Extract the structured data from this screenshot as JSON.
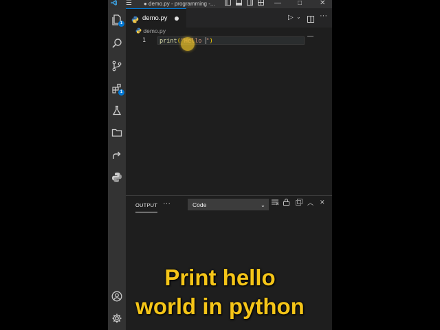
{
  "window": {
    "title": "● demo.py - programming -..."
  },
  "activity_bar": {
    "items": [
      {
        "name": "explorer-icon",
        "badge": "1"
      },
      {
        "name": "search-icon"
      },
      {
        "name": "source-control-icon"
      },
      {
        "name": "extensions-icon",
        "badge": "1"
      },
      {
        "name": "testing-icon"
      },
      {
        "name": "folder-icon"
      },
      {
        "name": "remote-explorer-icon"
      },
      {
        "name": "python-icon"
      }
    ],
    "bottom": [
      {
        "name": "account-icon"
      },
      {
        "name": "settings-gear-icon"
      }
    ]
  },
  "tab": {
    "label": "demo.py",
    "dirty": true
  },
  "breadcrumb": {
    "file": "demo.py"
  },
  "editor": {
    "line_number": "1",
    "code_fn": "print",
    "code_open": "(",
    "code_string": "\"Hello ",
    "code_string_end": "\"",
    "code_close": ")"
  },
  "panel": {
    "tab": "OUTPUT",
    "more": "···",
    "channel": "Code"
  },
  "caption": {
    "line1": "Print hello",
    "line2": "world in python"
  },
  "colors": {
    "accent": "#0078d4",
    "caption": "#f5c518",
    "editor_bg": "#1e1e1e"
  }
}
